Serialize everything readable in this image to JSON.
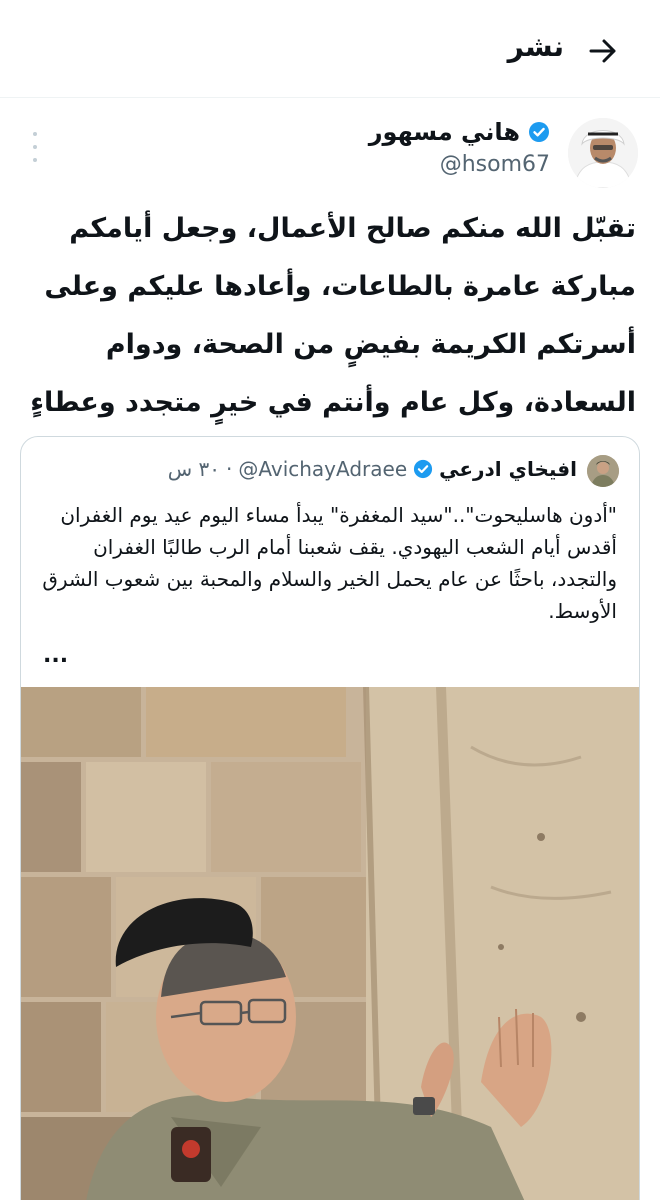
{
  "header": {
    "title": "نشر",
    "back_icon": "arrow-right-icon"
  },
  "tweet": {
    "author_name": "هاني مسهور",
    "author_handle": "@hsom67",
    "verified": true,
    "text": "تقبّل الله منكم صالح الأعمال، وجعل أيامكم مباركة عامرة بالطاعات، وأعادها عليكم وعلى أسرتكم الكريمة بفيضٍ من الصحة، ودوام السعادة، وكل عام وأنتم في خيرٍ متجدد وعطاءٍ موصول"
  },
  "quote": {
    "author_name": "افيخاي ادرعي",
    "author_handle": "@AvichayAdraee",
    "verified": true,
    "time": "٣٠ س",
    "separator": "·",
    "text": "\"أدون هاسليحوت\"..\"سيد المغفرة\" يبدأ مساء اليوم عيد يوم الغفران أقدس أيام الشعب اليهودي. يقف شعبنا أمام الرب طالبًا الغفران والتجدد، باحثًا عن عام يحمل الخير والسلام والمحبة بين شعوب الشرق الأوسط.",
    "ellipsis": "..."
  },
  "colors": {
    "verified": "#1d9bf0",
    "secondary_text": "#536471",
    "border": "#cfd9de"
  }
}
